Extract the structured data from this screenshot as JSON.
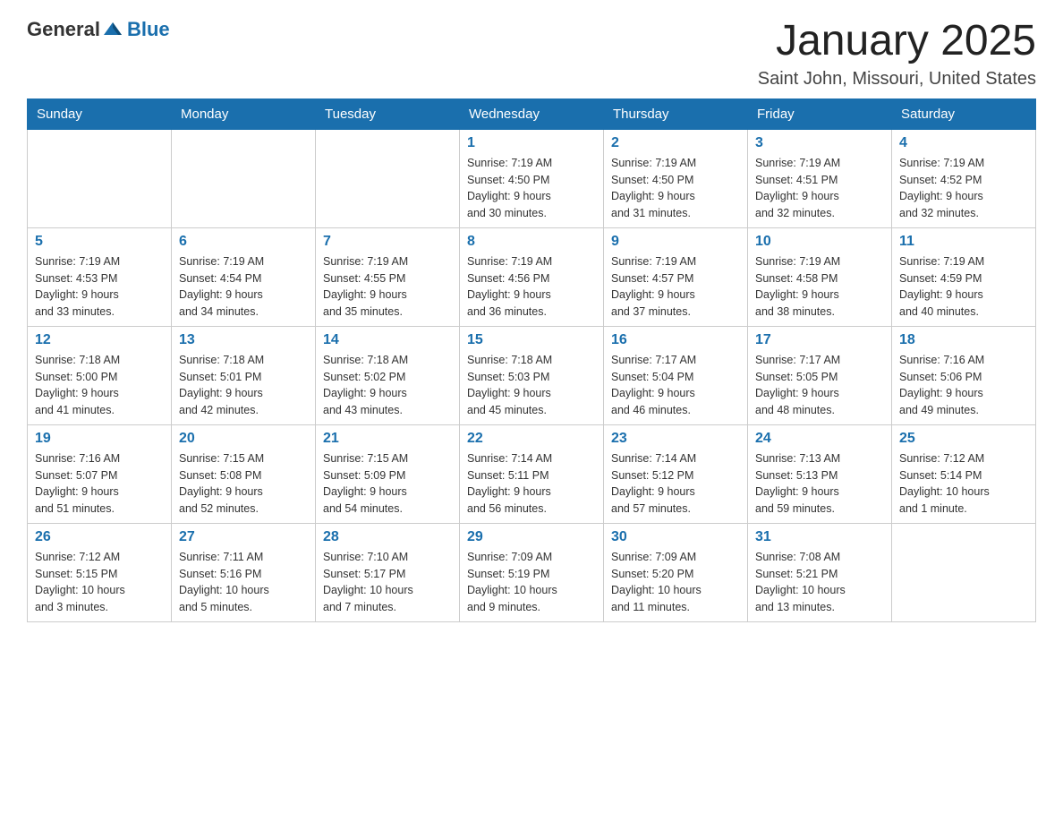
{
  "header": {
    "logo_general": "General",
    "logo_blue": "Blue",
    "title": "January 2025",
    "subtitle": "Saint John, Missouri, United States"
  },
  "weekdays": [
    "Sunday",
    "Monday",
    "Tuesday",
    "Wednesday",
    "Thursday",
    "Friday",
    "Saturday"
  ],
  "weeks": [
    [
      {
        "day": "",
        "info": ""
      },
      {
        "day": "",
        "info": ""
      },
      {
        "day": "",
        "info": ""
      },
      {
        "day": "1",
        "info": "Sunrise: 7:19 AM\nSunset: 4:50 PM\nDaylight: 9 hours\nand 30 minutes."
      },
      {
        "day": "2",
        "info": "Sunrise: 7:19 AM\nSunset: 4:50 PM\nDaylight: 9 hours\nand 31 minutes."
      },
      {
        "day": "3",
        "info": "Sunrise: 7:19 AM\nSunset: 4:51 PM\nDaylight: 9 hours\nand 32 minutes."
      },
      {
        "day": "4",
        "info": "Sunrise: 7:19 AM\nSunset: 4:52 PM\nDaylight: 9 hours\nand 32 minutes."
      }
    ],
    [
      {
        "day": "5",
        "info": "Sunrise: 7:19 AM\nSunset: 4:53 PM\nDaylight: 9 hours\nand 33 minutes."
      },
      {
        "day": "6",
        "info": "Sunrise: 7:19 AM\nSunset: 4:54 PM\nDaylight: 9 hours\nand 34 minutes."
      },
      {
        "day": "7",
        "info": "Sunrise: 7:19 AM\nSunset: 4:55 PM\nDaylight: 9 hours\nand 35 minutes."
      },
      {
        "day": "8",
        "info": "Sunrise: 7:19 AM\nSunset: 4:56 PM\nDaylight: 9 hours\nand 36 minutes."
      },
      {
        "day": "9",
        "info": "Sunrise: 7:19 AM\nSunset: 4:57 PM\nDaylight: 9 hours\nand 37 minutes."
      },
      {
        "day": "10",
        "info": "Sunrise: 7:19 AM\nSunset: 4:58 PM\nDaylight: 9 hours\nand 38 minutes."
      },
      {
        "day": "11",
        "info": "Sunrise: 7:19 AM\nSunset: 4:59 PM\nDaylight: 9 hours\nand 40 minutes."
      }
    ],
    [
      {
        "day": "12",
        "info": "Sunrise: 7:18 AM\nSunset: 5:00 PM\nDaylight: 9 hours\nand 41 minutes."
      },
      {
        "day": "13",
        "info": "Sunrise: 7:18 AM\nSunset: 5:01 PM\nDaylight: 9 hours\nand 42 minutes."
      },
      {
        "day": "14",
        "info": "Sunrise: 7:18 AM\nSunset: 5:02 PM\nDaylight: 9 hours\nand 43 minutes."
      },
      {
        "day": "15",
        "info": "Sunrise: 7:18 AM\nSunset: 5:03 PM\nDaylight: 9 hours\nand 45 minutes."
      },
      {
        "day": "16",
        "info": "Sunrise: 7:17 AM\nSunset: 5:04 PM\nDaylight: 9 hours\nand 46 minutes."
      },
      {
        "day": "17",
        "info": "Sunrise: 7:17 AM\nSunset: 5:05 PM\nDaylight: 9 hours\nand 48 minutes."
      },
      {
        "day": "18",
        "info": "Sunrise: 7:16 AM\nSunset: 5:06 PM\nDaylight: 9 hours\nand 49 minutes."
      }
    ],
    [
      {
        "day": "19",
        "info": "Sunrise: 7:16 AM\nSunset: 5:07 PM\nDaylight: 9 hours\nand 51 minutes."
      },
      {
        "day": "20",
        "info": "Sunrise: 7:15 AM\nSunset: 5:08 PM\nDaylight: 9 hours\nand 52 minutes."
      },
      {
        "day": "21",
        "info": "Sunrise: 7:15 AM\nSunset: 5:09 PM\nDaylight: 9 hours\nand 54 minutes."
      },
      {
        "day": "22",
        "info": "Sunrise: 7:14 AM\nSunset: 5:11 PM\nDaylight: 9 hours\nand 56 minutes."
      },
      {
        "day": "23",
        "info": "Sunrise: 7:14 AM\nSunset: 5:12 PM\nDaylight: 9 hours\nand 57 minutes."
      },
      {
        "day": "24",
        "info": "Sunrise: 7:13 AM\nSunset: 5:13 PM\nDaylight: 9 hours\nand 59 minutes."
      },
      {
        "day": "25",
        "info": "Sunrise: 7:12 AM\nSunset: 5:14 PM\nDaylight: 10 hours\nand 1 minute."
      }
    ],
    [
      {
        "day": "26",
        "info": "Sunrise: 7:12 AM\nSunset: 5:15 PM\nDaylight: 10 hours\nand 3 minutes."
      },
      {
        "day": "27",
        "info": "Sunrise: 7:11 AM\nSunset: 5:16 PM\nDaylight: 10 hours\nand 5 minutes."
      },
      {
        "day": "28",
        "info": "Sunrise: 7:10 AM\nSunset: 5:17 PM\nDaylight: 10 hours\nand 7 minutes."
      },
      {
        "day": "29",
        "info": "Sunrise: 7:09 AM\nSunset: 5:19 PM\nDaylight: 10 hours\nand 9 minutes."
      },
      {
        "day": "30",
        "info": "Sunrise: 7:09 AM\nSunset: 5:20 PM\nDaylight: 10 hours\nand 11 minutes."
      },
      {
        "day": "31",
        "info": "Sunrise: 7:08 AM\nSunset: 5:21 PM\nDaylight: 10 hours\nand 13 minutes."
      },
      {
        "day": "",
        "info": ""
      }
    ]
  ]
}
